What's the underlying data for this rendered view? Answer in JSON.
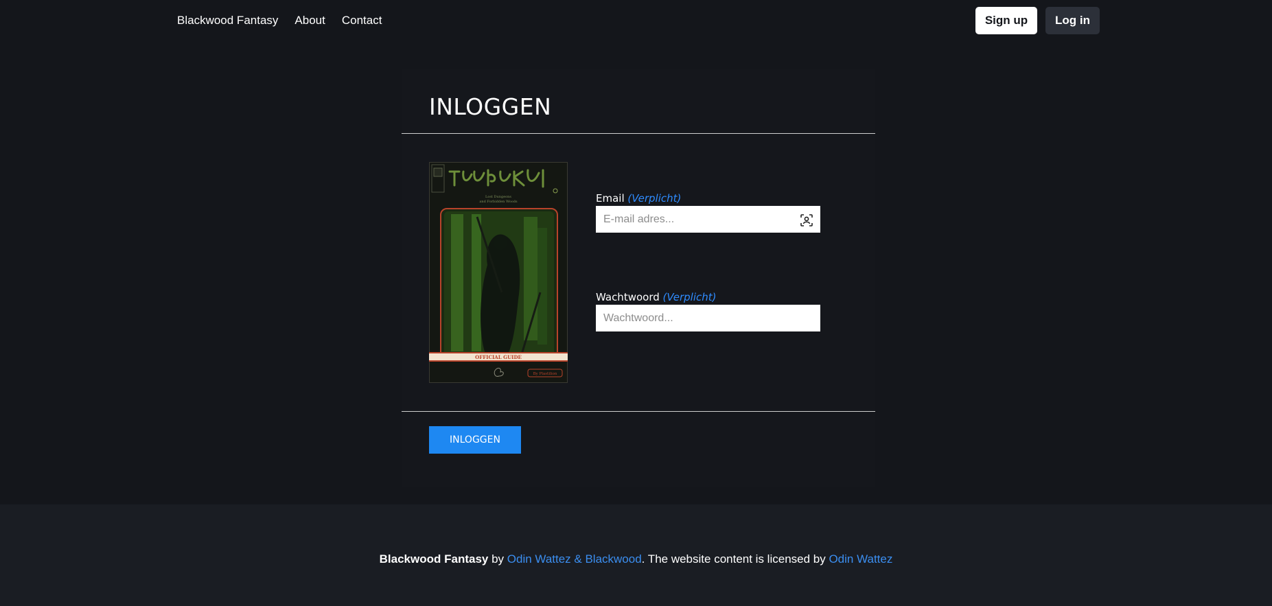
{
  "nav": {
    "brand": "Blackwood Fantasy",
    "links": [
      "About",
      "Contact"
    ],
    "signup_label": "Sign up",
    "login_label": "Log in"
  },
  "login": {
    "title": "INLOGGEN",
    "email_label": "Email",
    "email_required": "(Verplicht)",
    "email_placeholder": "E-mail adres...",
    "password_label": "Wachtwoord",
    "password_required": "(Verplicht)",
    "password_placeholder": "Wachtwoord...",
    "submit_label": "INLOGGEN"
  },
  "cover": {
    "subtitle_line1": "Lost Dungeons",
    "subtitle_line2": "and Forbidden Woods",
    "banner": "OFFICIAL GUIDE",
    "credit": "By Plastilion"
  },
  "footer": {
    "brand": "Blackwood Fantasy",
    "by": " by ",
    "authors": "Odin Wattez & Blackwood",
    "license_text": ". The website content is licensed by ",
    "licensor": "Odin Wattez"
  },
  "colors": {
    "background": "#14161b",
    "accent": "#1e88f2",
    "link": "#3b8ef0"
  },
  "icons": [
    "contact-card-icon"
  ]
}
